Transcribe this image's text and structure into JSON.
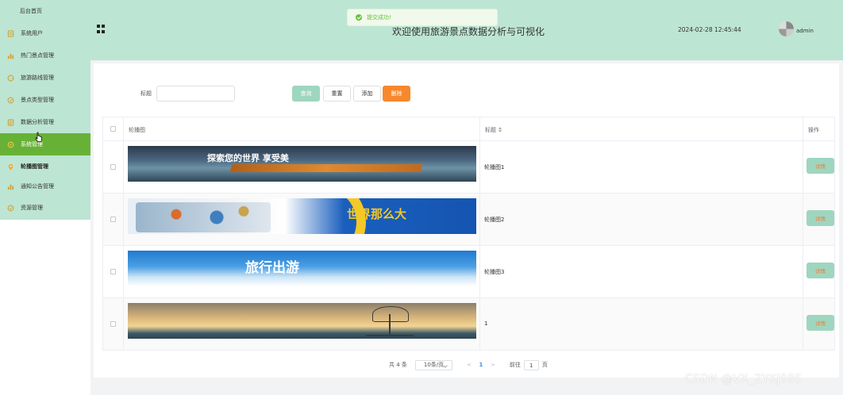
{
  "sidebar": {
    "items": [
      {
        "label": "后台首页",
        "icon": "home-icon"
      },
      {
        "label": "系统用户",
        "icon": "user-doc-icon"
      },
      {
        "label": "热门景点管理",
        "icon": "bar-chart-icon"
      },
      {
        "label": "旅游路线管理",
        "icon": "chat-icon"
      },
      {
        "label": "景点类型管理",
        "icon": "check-circle-icon"
      },
      {
        "label": "数据分析管理",
        "icon": "document-icon"
      },
      {
        "label": "系统管理",
        "icon": "gear-icon"
      },
      {
        "label": "轮播图管理",
        "icon": "location-pin-icon"
      },
      {
        "label": "通知公告管理",
        "icon": "bar-chart-icon"
      },
      {
        "label": "资源管理",
        "icon": "check-circle-icon"
      }
    ]
  },
  "header": {
    "title": "欢迎使用旅游景点数据分析与可视化",
    "datetime": "2024-02-28 12:45:44",
    "username": "admin"
  },
  "toast": {
    "message": "提交成功!"
  },
  "search": {
    "label": "标题",
    "query_btn": "查询",
    "reset_btn": "重置",
    "add_btn": "添加",
    "delete_btn": "删除"
  },
  "table": {
    "columns": [
      "轮播图",
      "标题",
      "操作"
    ],
    "rows": [
      {
        "title": "轮播图1",
        "action": "详情",
        "banner_text": "探索您的世界 享受美"
      },
      {
        "title": "轮播图2",
        "action": "详情",
        "banner_text": "世界那么大"
      },
      {
        "title": "轮播图3",
        "action": "详情",
        "banner_text": "旅行出游"
      },
      {
        "title": "1",
        "action": "详情",
        "banner_text": ""
      }
    ]
  },
  "pagination": {
    "total": "共 4 条",
    "page_size": "10条/页",
    "prev": "<",
    "current": "1",
    "next": ">",
    "goto_label": "前往",
    "goto_value": "1",
    "page_unit": "页"
  },
  "watermark": "CSDN @VX_ZYKJ985",
  "colors": {
    "sidebar_bg": "#bde5d3",
    "active": "#67b236",
    "delete": "#f7882d",
    "primary_btn": "#9fd6bf"
  }
}
